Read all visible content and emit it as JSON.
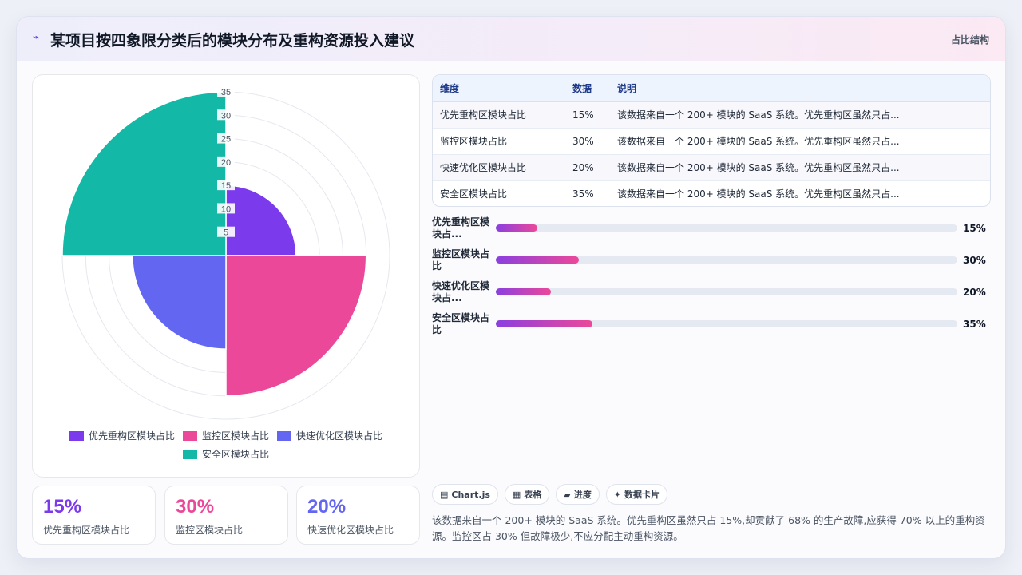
{
  "header": {
    "logo_icon": "sparkline-icon",
    "title": "某项目按四象限分类后的模块分布及重构资源投入建议",
    "tag": "占比结构"
  },
  "chart_data": {
    "type": "polarArea",
    "categories": [
      "优先重构区模块占比",
      "监控区模块占比",
      "快速优化区模块占比",
      "安全区模块占比"
    ],
    "values": [
      15,
      30,
      20,
      35
    ],
    "colors": [
      "#7c3aed",
      "#ec4899",
      "#6366f1",
      "#14b8a6"
    ],
    "r_ticks": [
      5,
      10,
      15,
      20,
      25,
      30,
      35
    ],
    "r_range": [
      0,
      35
    ],
    "legend_position": "bottom"
  },
  "legend": [
    {
      "label": "优先重构区模块占比",
      "color": "#7c3aed"
    },
    {
      "label": "监控区模块占比",
      "color": "#ec4899"
    },
    {
      "label": "快速优化区模块占比",
      "color": "#6366f1"
    },
    {
      "label": "安全区模块占比",
      "color": "#14b8a6"
    }
  ],
  "stats": [
    {
      "value": "15%",
      "label": "优先重构区模块占比",
      "color": "#7c3aed"
    },
    {
      "value": "30%",
      "label": "监控区模块占比",
      "color": "#ec4899"
    },
    {
      "value": "20%",
      "label": "快速优化区模块占比",
      "color": "#6366f1"
    }
  ],
  "table": {
    "headers": [
      "维度",
      "数据",
      "说明"
    ],
    "rows": [
      [
        "优先重构区模块占比",
        "15%",
        "该数据来自一个 200+ 模块的 SaaS 系统。优先重构区虽然只占..."
      ],
      [
        "监控区模块占比",
        "30%",
        "该数据来自一个 200+ 模块的 SaaS 系统。优先重构区虽然只占..."
      ],
      [
        "快速优化区模块占比",
        "20%",
        "该数据来自一个 200+ 模块的 SaaS 系统。优先重构区虽然只占..."
      ],
      [
        "安全区模块占比",
        "35%",
        "该数据来自一个 200+ 模块的 SaaS 系统。优先重构区虽然只占..."
      ]
    ]
  },
  "progress": [
    {
      "label": "优先重构区模块占...",
      "pct_text": "15%",
      "value": 15
    },
    {
      "label": "监控区模块占比",
      "pct_text": "30%",
      "value": 30
    },
    {
      "label": "快速优化区模块占...",
      "pct_text": "20%",
      "value": 20
    },
    {
      "label": "安全区模块占比",
      "pct_text": "35%",
      "value": 35
    }
  ],
  "chips": [
    {
      "icon": "▤",
      "label": "Chart.js"
    },
    {
      "icon": "▦",
      "label": "表格"
    },
    {
      "icon": "▰",
      "label": "进度"
    },
    {
      "icon": "✦",
      "label": "数据卡片"
    }
  ],
  "summary": "该数据来自一个 200+ 模块的 SaaS 系统。优先重构区虽然只占 15%,却贡献了 68% 的生产故障,应获得 70% 以上的重构资源。监控区占 30% 但故障极少,不应分配主动重构资源。"
}
